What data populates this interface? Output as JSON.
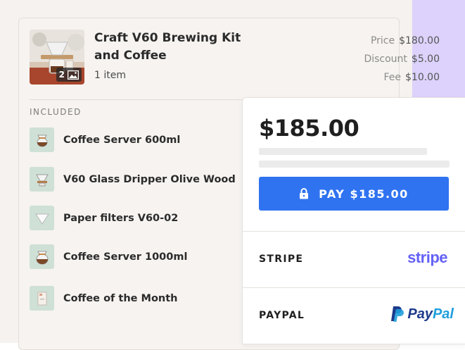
{
  "colors": {
    "accent": "#2f73f0",
    "stripe": "#6461f6",
    "paypal_dark": "#1d3b8c",
    "paypal_light": "#1f9fdc",
    "item_icon_bg": "#cfe0d6"
  },
  "product": {
    "title": "Craft V60 Brewing Kit and Coffee",
    "items": "1 item",
    "image_count": "2",
    "image_icon": "image-icon"
  },
  "pricing": {
    "price_label": "Price",
    "price_value": "$180.00",
    "discount_label": "Discount",
    "discount_value": "$5.00",
    "fee_label": "Fee",
    "fee_value": "$10.00"
  },
  "included": {
    "heading": "INCLUDED",
    "items": [
      {
        "label": "Coffee Server 600ml",
        "icon": "coffee-server-icon"
      },
      {
        "label": "V60 Glass Dripper Olive Wood",
        "icon": "dripper-icon"
      },
      {
        "label": "Paper filters V60-02",
        "icon": "paper-filter-icon"
      },
      {
        "label": "Coffee Server 1000ml",
        "icon": "coffee-server-icon"
      },
      {
        "label": "Coffee of the Month",
        "icon": "coffee-bag-icon"
      }
    ]
  },
  "checkout": {
    "total": "$185.00",
    "pay_button": "PAY $185.00",
    "pay_icon": "lock-icon",
    "methods": [
      {
        "name": "STRIPE",
        "logo": "stripe"
      },
      {
        "name": "PAYPAL",
        "logo_a": "Pay",
        "logo_b": "Pal"
      }
    ]
  }
}
